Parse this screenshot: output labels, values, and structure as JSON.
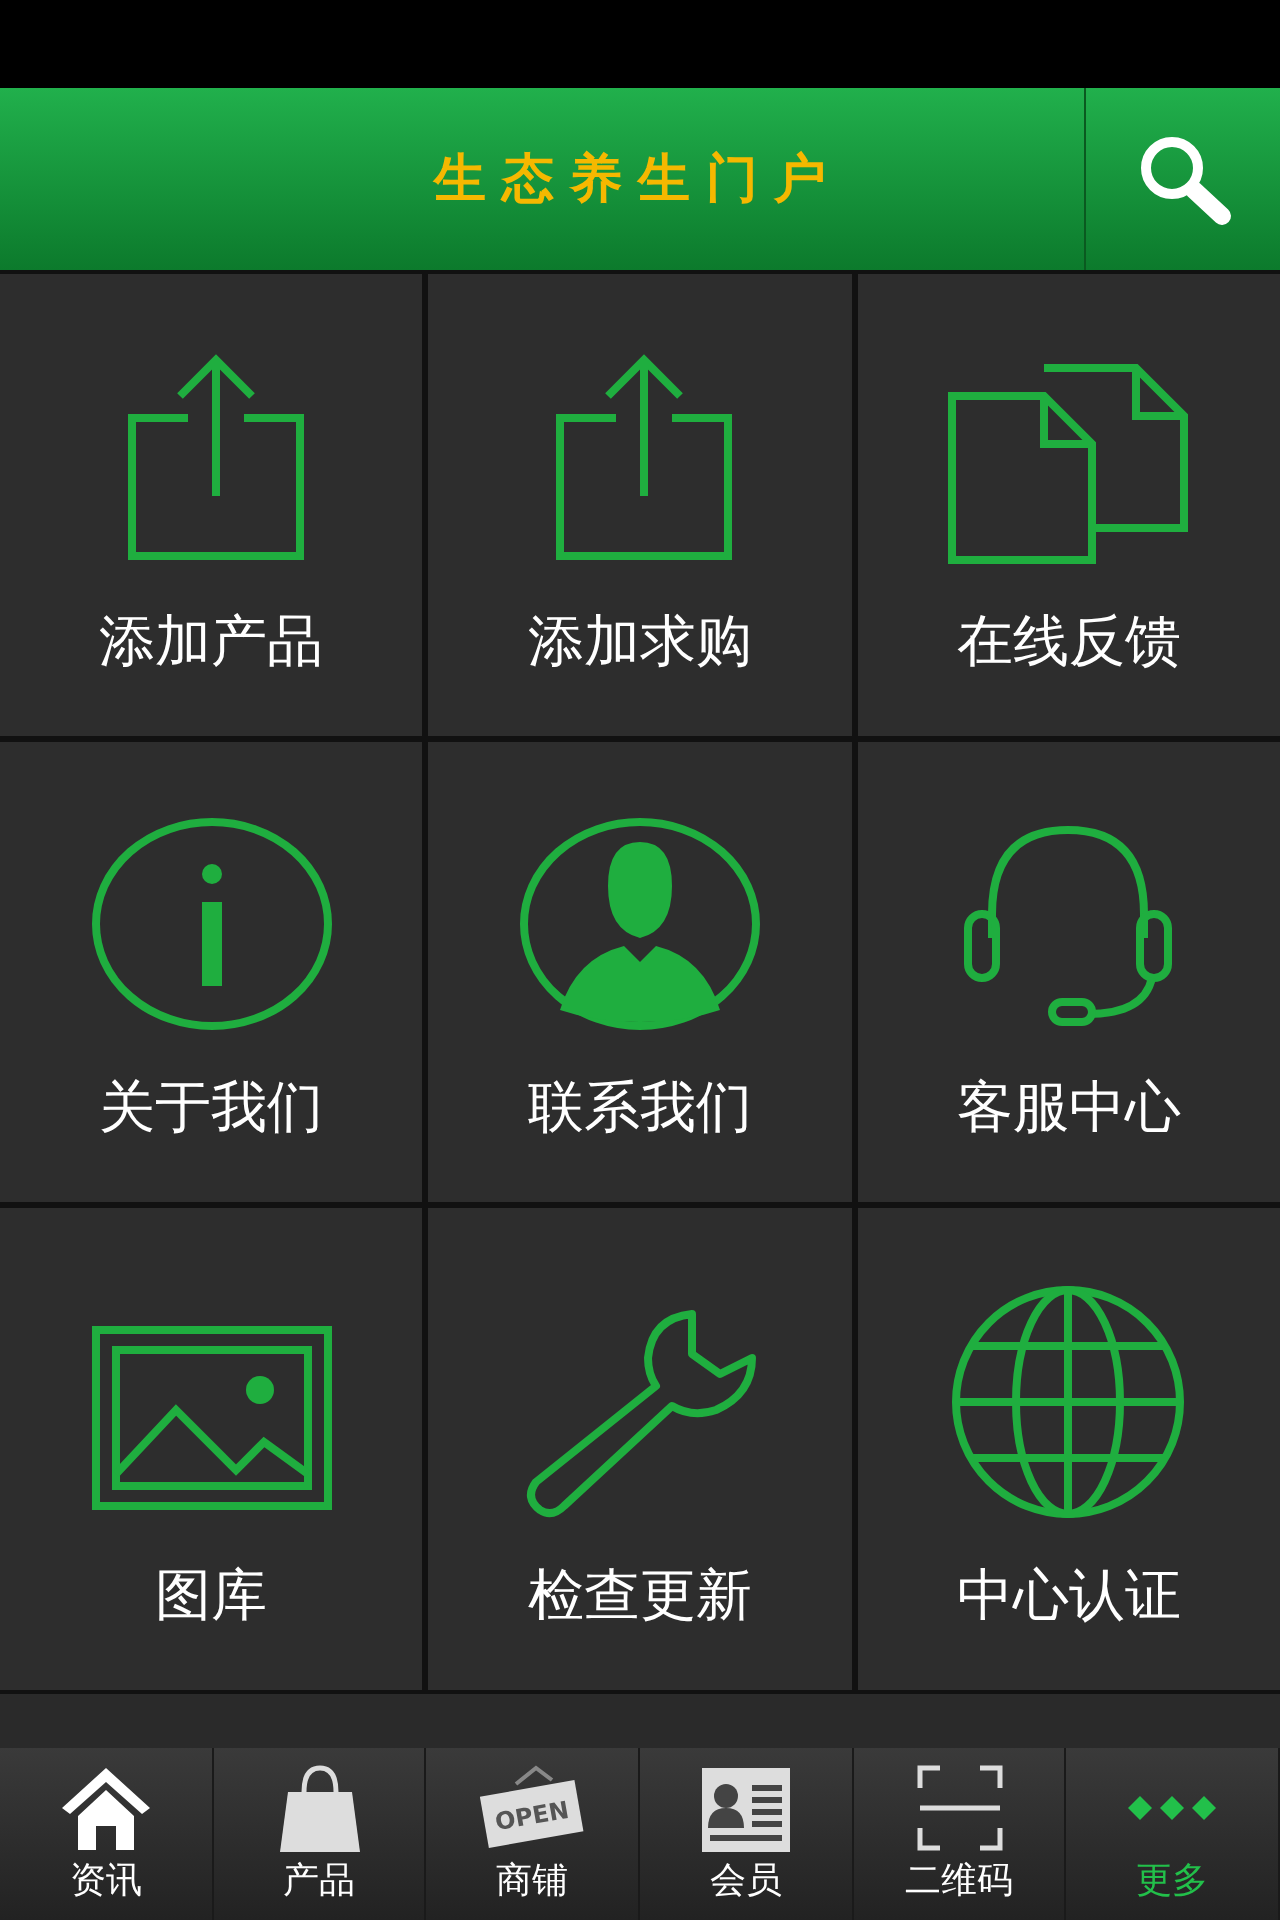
{
  "header": {
    "title": "生态养生门户"
  },
  "tiles": [
    {
      "label": "添加产品",
      "kind": "upload"
    },
    {
      "label": "添加求购",
      "kind": "upload"
    },
    {
      "label": "在线反馈",
      "kind": "documents"
    },
    {
      "label": "关于我们",
      "kind": "info"
    },
    {
      "label": "联系我们",
      "kind": "person"
    },
    {
      "label": "客服中心",
      "kind": "headset"
    },
    {
      "label": "图库",
      "kind": "image"
    },
    {
      "label": "检查更新",
      "kind": "wrench"
    },
    {
      "label": "中心认证",
      "kind": "globe"
    }
  ],
  "tabbar": [
    {
      "label": "资讯",
      "kind": "home",
      "selected": false
    },
    {
      "label": "产品",
      "kind": "bag",
      "selected": false
    },
    {
      "label": "商铺",
      "kind": "sign",
      "sign_text": "OPEN",
      "selected": false
    },
    {
      "label": "会员",
      "kind": "card",
      "selected": false
    },
    {
      "label": "二维码",
      "kind": "scan",
      "selected": false
    },
    {
      "label": "更多",
      "kind": "more",
      "selected": true
    }
  ]
}
